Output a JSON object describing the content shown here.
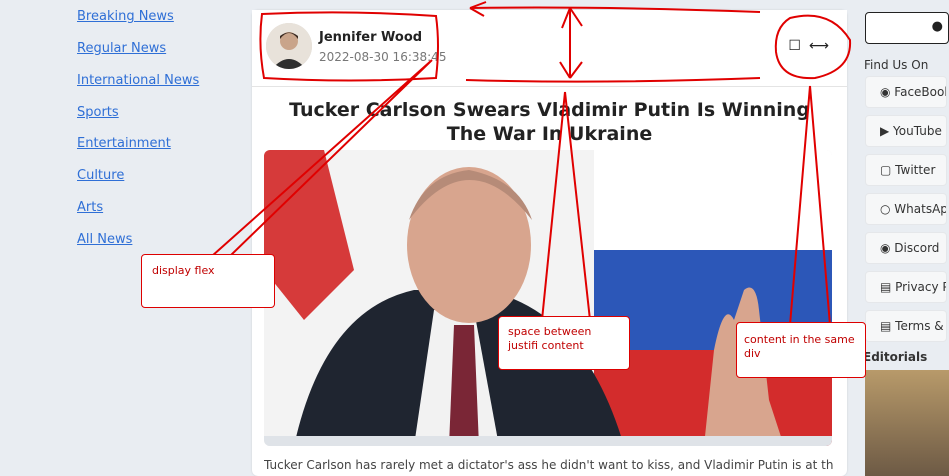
{
  "sidebar": {
    "items": [
      "Breaking News",
      "Regular News",
      "International News",
      "Sports",
      "Entertainment",
      "Culture",
      "Arts",
      "All News"
    ]
  },
  "post": {
    "author": "Jennifer Wood",
    "datetime": "2022-08-30 16:38:45",
    "headline": "Tucker Carlson Swears Vladimir Putin Is Winning The War In Ukraine",
    "excerpt": "Tucker Carlson has rarely met a dictator's ass he didn't want to kiss, and Vladimir Putin is at the very"
  },
  "right_panel": {
    "find_us_on": "Find Us On",
    "links": [
      "FaceBook",
      "YouTube",
      "Twitter",
      "WhatsApp",
      "Discord",
      "Privacy Po",
      "Terms & C"
    ],
    "editorials": "Editorials"
  },
  "annotations": {
    "display_flex": "display flex",
    "space_between": "space between justifi content",
    "same_div": "content in the same div"
  },
  "colors": {
    "link": "#2f6fd6",
    "annotation": "#e00000"
  }
}
